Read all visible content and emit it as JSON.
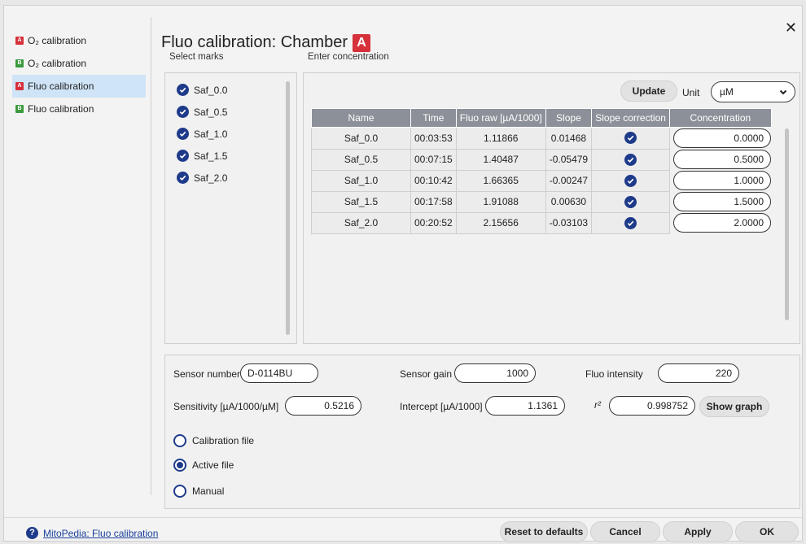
{
  "sidebar": {
    "items": [
      {
        "badge": "A",
        "label": "O₂ calibration",
        "color": "#d6303a",
        "active": false
      },
      {
        "badge": "B",
        "label": "O₂ calibration",
        "color": "#3a9a3c",
        "active": false
      },
      {
        "badge": "A",
        "label": "Fluo calibration",
        "color": "#d6303a",
        "active": true
      },
      {
        "badge": "B",
        "label": "Fluo calibration",
        "color": "#3a9a3c",
        "active": false
      }
    ]
  },
  "header": {
    "title": "Fluo calibration: Chamber",
    "chamber": "A",
    "select_marks_label": "Select marks",
    "enter_concentration_label": "Enter concentration"
  },
  "marks": [
    "Saf_0.0",
    "Saf_0.5",
    "Saf_1.0",
    "Saf_1.5",
    "Saf_2.0"
  ],
  "toolbar": {
    "update_label": "Update",
    "unit_label": "Unit",
    "unit_value": "µM"
  },
  "table": {
    "columns": [
      "Name",
      "Time",
      "Fluo raw [µA/1000]",
      "Slope",
      "Slope correction",
      "Concentration"
    ],
    "rows": [
      {
        "name": "Saf_0.0",
        "time": "00:03:53",
        "fluo": "1.11866",
        "slope": "0.01468",
        "conc": "0.0000"
      },
      {
        "name": "Saf_0.5",
        "time": "00:07:15",
        "fluo": "1.40487",
        "slope": "-0.05479",
        "conc": "0.5000"
      },
      {
        "name": "Saf_1.0",
        "time": "00:10:42",
        "fluo": "1.66365",
        "slope": "-0.00247",
        "conc": "1.0000"
      },
      {
        "name": "Saf_1.5",
        "time": "00:17:58",
        "fluo": "1.91088",
        "slope": "0.00630",
        "conc": "1.5000"
      },
      {
        "name": "Saf_2.0",
        "time": "00:20:52",
        "fluo": "2.15656",
        "slope": "-0.03103",
        "conc": "2.0000"
      }
    ]
  },
  "sensor": {
    "number_label": "Sensor number",
    "number_value": "D-0114BU",
    "gain_label": "Sensor gain",
    "gain_value": "1000",
    "intensity_label": "Fluo intensity",
    "intensity_value": "220",
    "sensitivity_label": "Sensitivity [µA/1000/µM]",
    "sensitivity_value": "0.5216",
    "intercept_label": "Intercept [µA/1000]",
    "intercept_value": "1.1361",
    "r2_label": "r²",
    "r2_value": "0.998752",
    "show_graph_label": "Show graph"
  },
  "source": {
    "options": [
      {
        "label": "Calibration file",
        "checked": false
      },
      {
        "label": "Active file",
        "checked": true
      },
      {
        "label": "Manual",
        "checked": false
      }
    ]
  },
  "footer": {
    "help_link": "MitoPedia: Fluo calibration",
    "reset_label": "Reset to defaults",
    "cancel_label": "Cancel",
    "apply_label": "Apply",
    "ok_label": "OK"
  },
  "colors": {
    "accent": "#1e3a8a",
    "chamber_a": "#d6303a",
    "chamber_b": "#3a9a3c",
    "table_header": "#8c9199",
    "active_item": "#cfe4f7"
  }
}
